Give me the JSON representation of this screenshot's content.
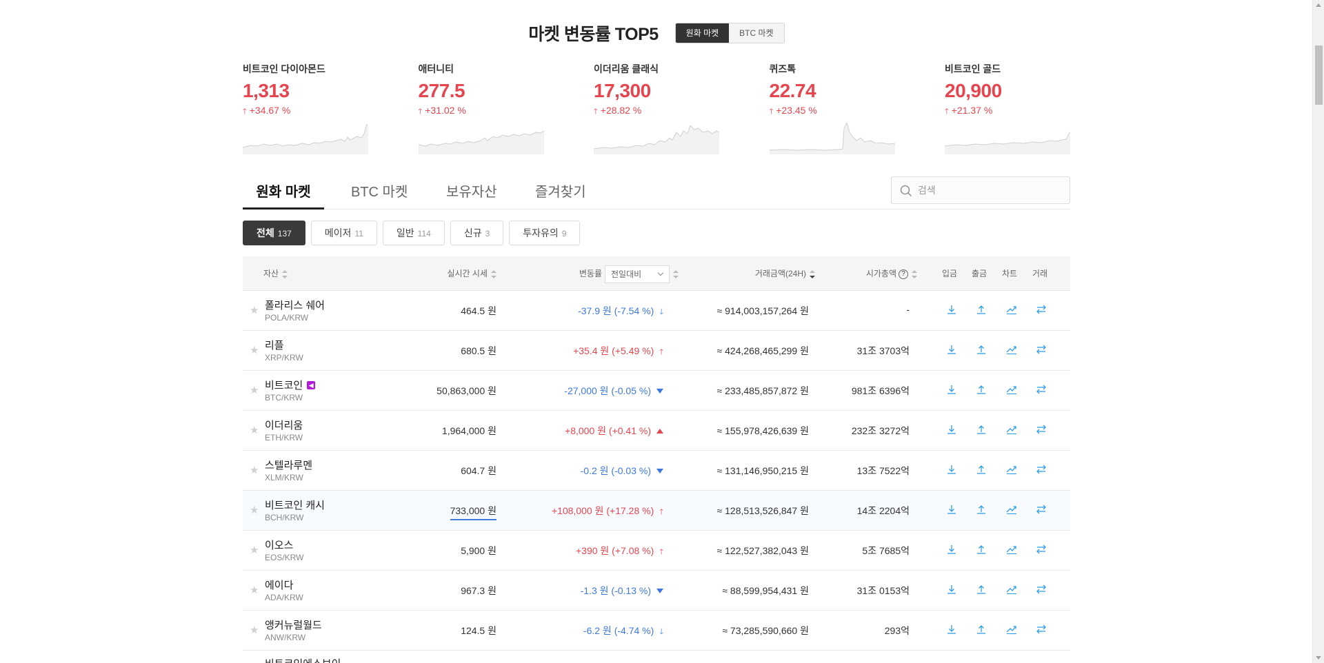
{
  "top5": {
    "title": "마켓 변동률 TOP5",
    "market_tabs": [
      "원화 마켓",
      "BTC 마켓"
    ],
    "active_tab": 0,
    "cards": [
      {
        "name": "비트코인 다이아몬드",
        "price": "1,313",
        "rate": "+34.67 %"
      },
      {
        "name": "애터니티",
        "price": "277.5",
        "rate": "+31.02 %"
      },
      {
        "name": "이더리움 클래식",
        "price": "17,300",
        "rate": "+28.82 %"
      },
      {
        "name": "퀴즈톡",
        "price": "22.74",
        "rate": "+23.45 %"
      },
      {
        "name": "비트코인 골드",
        "price": "20,900",
        "rate": "+21.37 %"
      }
    ]
  },
  "tabs": {
    "items": [
      "원화 마켓",
      "BTC 마켓",
      "보유자산",
      "즐겨찾기"
    ],
    "active": 0
  },
  "search": {
    "placeholder": "검색",
    "value": ""
  },
  "filters": [
    {
      "label": "전체",
      "count": "137",
      "active": true
    },
    {
      "label": "메이저",
      "count": "11",
      "active": false
    },
    {
      "label": "일반",
      "count": "114",
      "active": false
    },
    {
      "label": "신규",
      "count": "3",
      "active": false
    },
    {
      "label": "투자유의",
      "count": "9",
      "active": false
    }
  ],
  "table": {
    "headers": {
      "asset": "자산",
      "price": "실시간 시세",
      "change": "변동률",
      "change_select": "전일대비",
      "volume": "거래금액(24H)",
      "cap": "시가총액",
      "cap_help": "?",
      "deposit": "입금",
      "withdraw": "출금",
      "chart": "차트",
      "trade": "거래"
    },
    "rows": [
      {
        "name": "폴라리스 쉐어",
        "code": "POLA/KRW",
        "price": "464.5 원",
        "change": "-37.9 원 (-7.54 %)",
        "dir": "down",
        "ind": "arrow",
        "volume": "≈ 914,003,157,264 원",
        "cap": "-"
      },
      {
        "name": "리플",
        "code": "XRP/KRW",
        "price": "680.5 원",
        "change": "+35.4 원 (+5.49 %)",
        "dir": "up",
        "ind": "arrow",
        "volume": "≈ 424,268,465,299 원",
        "cap": "31조 3703억"
      },
      {
        "name": "비트코인",
        "code": "BTC/KRW",
        "price": "50,863,000 원",
        "change": "-27,000 원 (-0.05 %)",
        "dir": "down",
        "ind": "tri",
        "volume": "≈ 233,485,857,872 원",
        "cap": "981조 6396억",
        "badge": true
      },
      {
        "name": "이더리움",
        "code": "ETH/KRW",
        "price": "1,964,000 원",
        "change": "+8,000 원 (+0.41 %)",
        "dir": "up",
        "ind": "tri",
        "volume": "≈ 155,978,426,639 원",
        "cap": "232조 3272억"
      },
      {
        "name": "스텔라루멘",
        "code": "XLM/KRW",
        "price": "604.7 원",
        "change": "-0.2 원 (-0.03 %)",
        "dir": "down",
        "ind": "tri",
        "volume": "≈ 131,146,950,215 원",
        "cap": "13조 7522억"
      },
      {
        "name": "비트코인 캐시",
        "code": "BCH/KRW",
        "price": "733,000 원",
        "change": "+108,000 원 (+17.28 %)",
        "dir": "up",
        "ind": "arrow",
        "volume": "≈ 128,513,526,847 원",
        "cap": "14조 2204억",
        "highlight": true
      },
      {
        "name": "이오스",
        "code": "EOS/KRW",
        "price": "5,900 원",
        "change": "+390 원 (+7.08 %)",
        "dir": "up",
        "ind": "arrow",
        "volume": "≈ 122,527,382,043 원",
        "cap": "5조 7685억"
      },
      {
        "name": "에이다",
        "code": "ADA/KRW",
        "price": "967.3 원",
        "change": "-1.3 원 (-0.13 %)",
        "dir": "down",
        "ind": "tri",
        "volume": "≈ 88,599,954,431 원",
        "cap": "31조 0153억"
      },
      {
        "name": "앵커뉴럴월드",
        "code": "ANW/KRW",
        "price": "124.5 원",
        "change": "-6.2 원 (-4.74 %)",
        "dir": "down",
        "ind": "arrow",
        "volume": "≈ 73,285,590,660 원",
        "cap": "293억"
      }
    ],
    "cutoff_row": "비트코인에스브이"
  },
  "colors": {
    "up": "#e6454f",
    "down": "#3e78de",
    "action": "#2f9de3"
  },
  "icons": [
    "search-icon",
    "star-icon",
    "arrow-up-icon",
    "arrow-down-icon",
    "deposit-icon",
    "withdraw-icon",
    "chart-icon",
    "trade-icon"
  ]
}
